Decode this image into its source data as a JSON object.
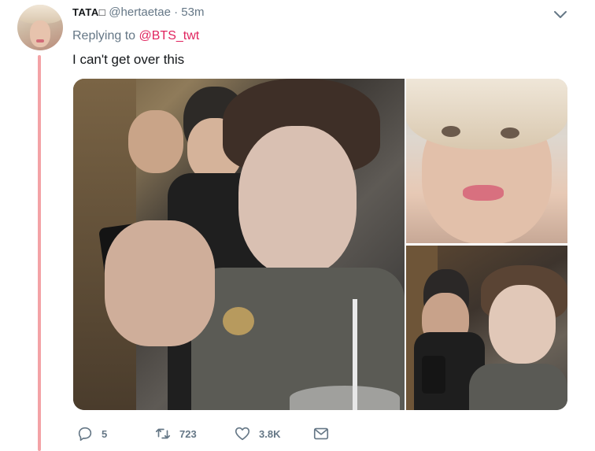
{
  "tweet": {
    "display_name": "TATA",
    "name_glyph": "□",
    "handle": "@hertaetae",
    "separator": "·",
    "time": "53m",
    "replying_prefix": "Replying to",
    "replying_to": "@BTS_twt",
    "text": "I can't get over this"
  },
  "media": {
    "photos": [
      {
        "label": "photo-main"
      },
      {
        "label": "photo-top-right"
      },
      {
        "label": "photo-bottom-right"
      }
    ]
  },
  "actions": {
    "reply_count": "5",
    "retweet_count": "723",
    "like_count": "3.8K"
  },
  "colors": {
    "accent_link": "#e0245e",
    "thread_line": "#f3a3a6",
    "muted_text": "#657786"
  },
  "icons": [
    "chevron-down-icon",
    "reply-icon",
    "retweet-icon",
    "like-icon",
    "message-icon"
  ]
}
